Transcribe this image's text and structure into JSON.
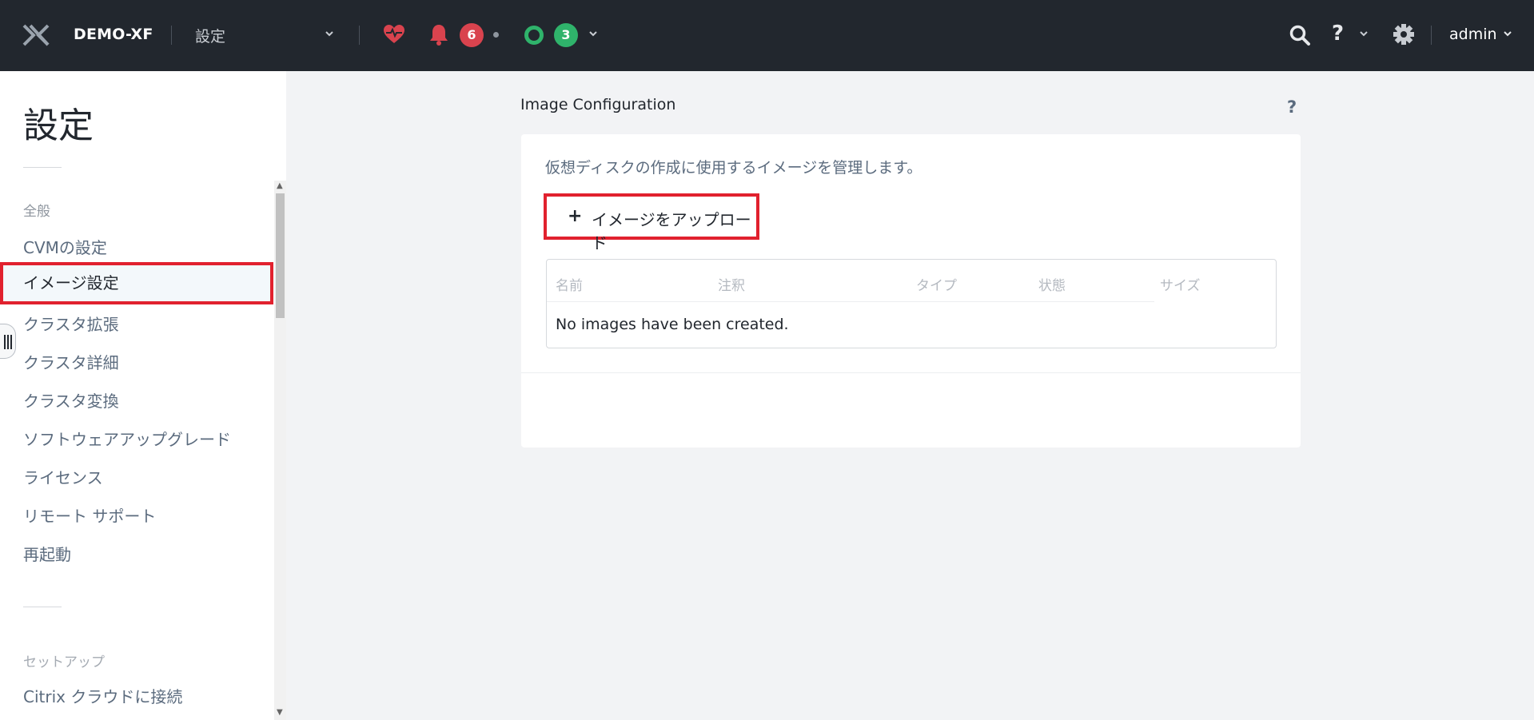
{
  "topbar": {
    "cluster_name": "DEMO-XF",
    "page_select": "設定",
    "alert_count": "6",
    "task_count": "3",
    "user": "admin",
    "icons": [
      "x-logo-icon",
      "heart-pulse-icon",
      "bell-icon",
      "circle-status-icon",
      "search-icon",
      "help-icon",
      "gear-icon"
    ],
    "colors": {
      "bar": "#22272e",
      "alert": "#d9434e",
      "ok": "#2fb36b"
    }
  },
  "sidebar": {
    "title": "設定",
    "section_general": "全般",
    "items": [
      {
        "label": "CVMの設定"
      },
      {
        "label": "イメージ設定"
      },
      {
        "label": "クラスタ拡張"
      },
      {
        "label": "クラスタ詳細"
      },
      {
        "label": "クラスタ変換"
      },
      {
        "label": "ソフトウェアアップグレード"
      },
      {
        "label": "ライセンス"
      },
      {
        "label": "リモート サポート"
      },
      {
        "label": "再起動"
      }
    ],
    "active_index": 1,
    "section_setup": "セットアップ",
    "setup_items": [
      {
        "label": "Citrix クラウドに接続"
      }
    ]
  },
  "main": {
    "title": "Image Configuration",
    "help": "?",
    "description": "仮想ディスクの作成に使用するイメージを管理します。",
    "upload_button": "イメージをアップロード",
    "table": {
      "columns": [
        "名前",
        "注釈",
        "タイプ",
        "状態",
        "サイズ"
      ],
      "empty_message": "No images have been created."
    }
  }
}
